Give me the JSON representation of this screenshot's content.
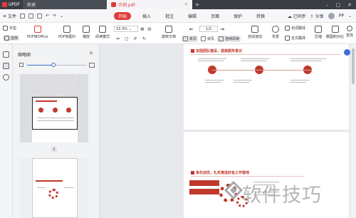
{
  "titlebar": {
    "app_name": "UPDF",
    "tabs": [
      {
        "label": "新建"
      },
      {
        "label": "示例.pdf"
      }
    ]
  },
  "menubar": {
    "file_label": "文件",
    "menus": [
      "开始",
      "插入",
      "批注",
      "编辑",
      "页面",
      "保护",
      "转换"
    ],
    "sync_label": "已同步",
    "share_label": "分享",
    "user_label": "PP"
  },
  "toolbar": {
    "hand_label": "手型",
    "select_label": "选择",
    "pdf_to_office": "PDF转Office",
    "pdf_to_image": "PDF转图片",
    "play": "播放",
    "read_mode": "阅读模式",
    "zoom": "33.3%",
    "rotate_doc": "旋转文档",
    "page_current": "1",
    "page_total": "/2",
    "single_page": "单页",
    "double_page": "双页",
    "continuous_read": "连续阅读",
    "auto_scroll": "自动滚动",
    "background": "背景",
    "translate_select": "划词翻译",
    "translate_full": "全文翻译",
    "compress": "压缩",
    "screenshot_compare": "截图和对比",
    "search": "查找"
  },
  "panel": {
    "title": "缩略图",
    "thumb1_page": "1"
  },
  "document": {
    "section1_title": "加强团队建设，提高服务意识",
    "section2_title": "争先创优，扎实推进好各工作落地"
  },
  "watermark": {
    "text": "软件技巧"
  }
}
